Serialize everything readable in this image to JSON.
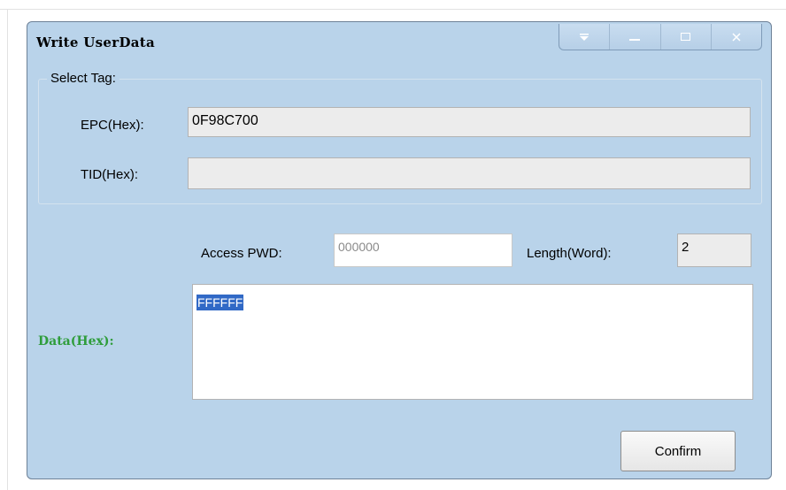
{
  "window": {
    "title": "Write UserData"
  },
  "select_tag": {
    "legend": "Select Tag:",
    "epc_label": "EPC(Hex):",
    "epc_value": "0F98C700",
    "tid_label": "TID(Hex):",
    "tid_value": ""
  },
  "access": {
    "pwd_label": "Access PWD:",
    "pwd_value": "000000",
    "length_label": "Length(Word):",
    "length_value": "2"
  },
  "data": {
    "label": "Data(Hex):",
    "value": "FFFFFF"
  },
  "buttons": {
    "confirm": "Confirm"
  },
  "colors": {
    "window_bg": "#b9d3ea",
    "data_label": "#2f9d3b",
    "selection": "#3169c6"
  }
}
